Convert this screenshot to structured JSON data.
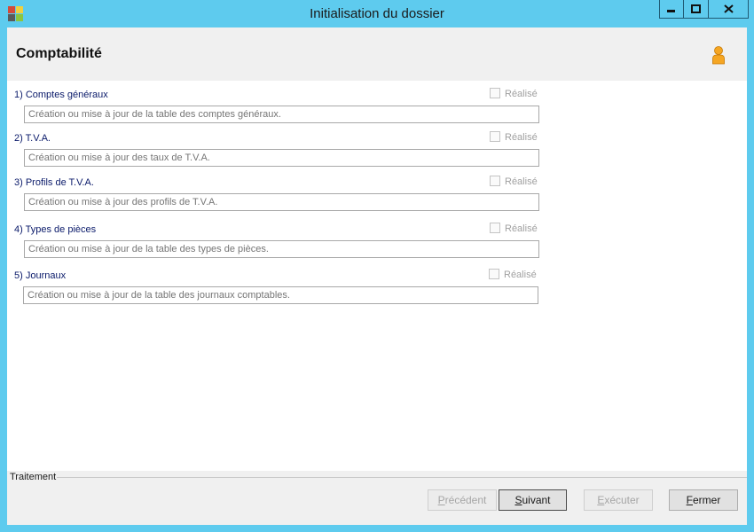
{
  "window": {
    "title": "Initialisation du dossier",
    "controls": {
      "minimize": "minimize",
      "maximize": "maximize",
      "close": "close"
    }
  },
  "header": {
    "title": "Comptabilité",
    "icon": "user-icon"
  },
  "steps": [
    {
      "label": "1) Comptes généraux",
      "realise_label": "Réalisé",
      "checked": false,
      "description": "Création ou mise à jour de la table des comptes généraux."
    },
    {
      "label": "2) T.V.A.",
      "realise_label": "Réalisé",
      "checked": false,
      "description": "Création ou mise à jour des taux de T.V.A."
    },
    {
      "label": "3) Profils de T.V.A.",
      "realise_label": "Réalisé",
      "checked": false,
      "description": "Création ou mise à jour des profils de T.V.A."
    },
    {
      "label": "4) Types de pièces",
      "realise_label": "Réalisé",
      "checked": false,
      "description": "Création ou mise à jour de la table des types de pièces."
    },
    {
      "label": "5) Journaux",
      "realise_label": "Réalisé",
      "checked": false,
      "description": "Création ou mise à jour de la table des journaux comptables."
    }
  ],
  "footer": {
    "group_label": "Traitement",
    "buttons": {
      "precedent": {
        "mnemonic": "P",
        "rest": "récédent",
        "enabled": false
      },
      "suivant": {
        "mnemonic": "S",
        "rest": "uivant",
        "enabled": true
      },
      "executer": {
        "mnemonic": "E",
        "rest": "xécuter",
        "enabled": false
      },
      "fermer": {
        "mnemonic": "F",
        "rest": "ermer",
        "enabled": true
      }
    }
  },
  "colors": {
    "frame": "#5ecbee",
    "header_bg": "#f0f0f0",
    "label": "#0a1a6a"
  }
}
